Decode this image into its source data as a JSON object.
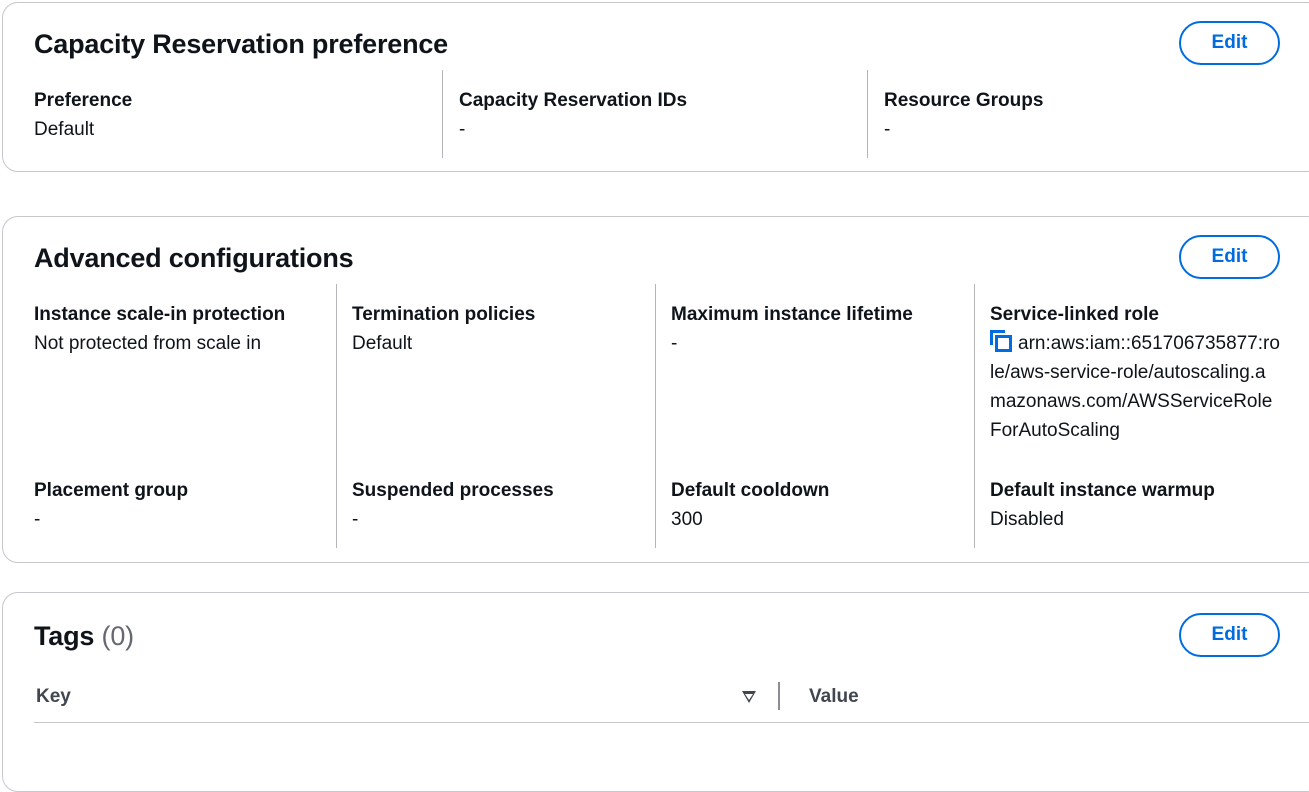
{
  "capacity": {
    "title": "Capacity Reservation preference",
    "edit_label": "Edit",
    "fields": [
      {
        "label": "Preference",
        "value": "Default"
      },
      {
        "label": "Capacity Reservation IDs",
        "value": "-"
      },
      {
        "label": "Resource Groups",
        "value": "-"
      }
    ]
  },
  "advanced": {
    "title": "Advanced configurations",
    "edit_label": "Edit",
    "row1": [
      {
        "label": "Instance scale-in protection",
        "value": "Not protected from scale in"
      },
      {
        "label": "Termination policies",
        "value": "Default"
      },
      {
        "label": "Maximum instance lifetime",
        "value": "-"
      },
      {
        "label": "Service-linked role",
        "value": "arn:aws:iam::651706735877:role/aws-service-role/autoscaling.amazonaws.com/AWSServiceRoleForAutoScaling"
      }
    ],
    "row2": [
      {
        "label": "Placement group",
        "value": "-"
      },
      {
        "label": "Suspended processes",
        "value": "-"
      },
      {
        "label": "Default cooldown",
        "value": "300"
      },
      {
        "label": "Default instance warmup",
        "value": "Disabled"
      }
    ]
  },
  "tags": {
    "title": "Tags",
    "count": "(0)",
    "edit_label": "Edit",
    "columns": {
      "key": "Key",
      "value": "Value"
    }
  },
  "colors": {
    "accent": "#006ce0",
    "border": "#c6c6cd",
    "text": "#0f141a"
  }
}
